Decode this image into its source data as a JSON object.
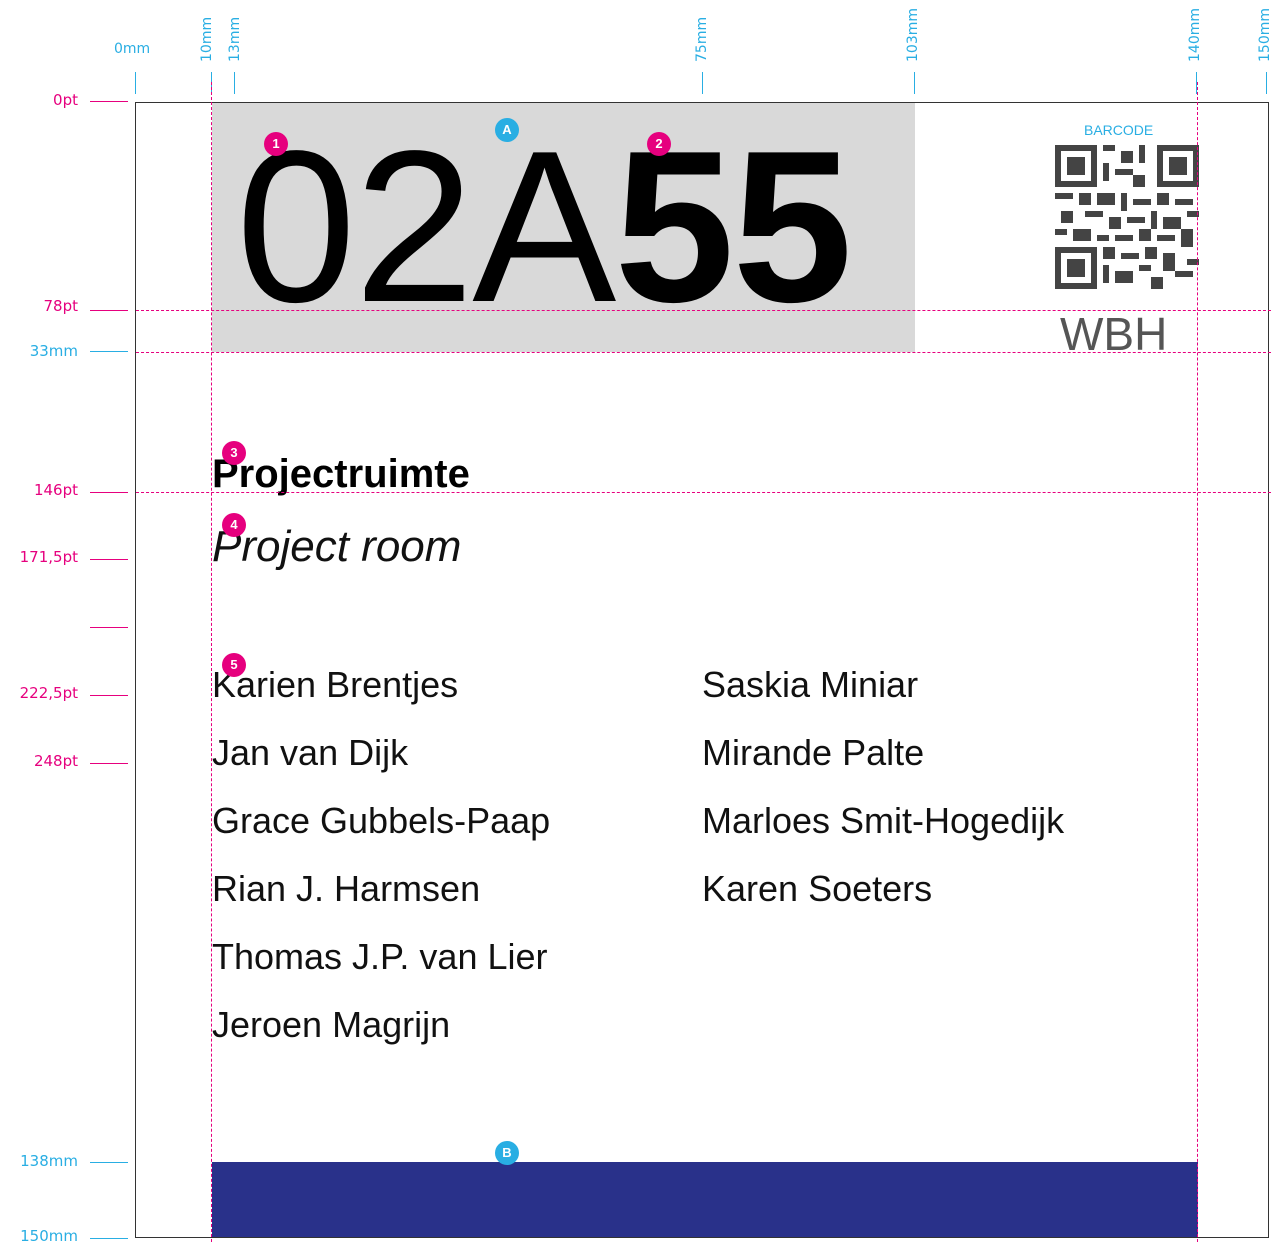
{
  "ruler_top": {
    "labels": [
      "0mm",
      "10mm",
      "13mm",
      "75mm",
      "103mm",
      "140mm",
      "150mm"
    ]
  },
  "ruler_left": {
    "labels": [
      "0pt",
      "78pt",
      "33mm",
      "146pt",
      "171,5pt",
      "222,5pt",
      "248pt",
      "138mm",
      "150mm"
    ]
  },
  "sign": {
    "room_number_regular": "02A",
    "room_number_bold": "55",
    "barcode_label": "BARCODE",
    "barcode_code": "WBH",
    "room_name_nl": "Projectruimte",
    "room_name_en": "Project room",
    "names_left": [
      "Karien Brentjes",
      "Jan van Dijk",
      "Grace Gubbels-Paap",
      "Rian J. Harmsen",
      "Thomas J.P. van Lier",
      "Jeroen Magrijn"
    ],
    "names_right": [
      "Saskia Miniar",
      "Mirande Palte",
      "Marloes Smit-Hogedijk",
      "Karen Soeters"
    ]
  },
  "markers": {
    "pink": [
      "1",
      "2",
      "3",
      "4",
      "5"
    ],
    "blue": [
      "A",
      "B"
    ]
  },
  "colors": {
    "guide": "#e6007e",
    "ruler": "#29aee3",
    "number_band": "#d9d9d9",
    "footer_band": "#29318a"
  }
}
